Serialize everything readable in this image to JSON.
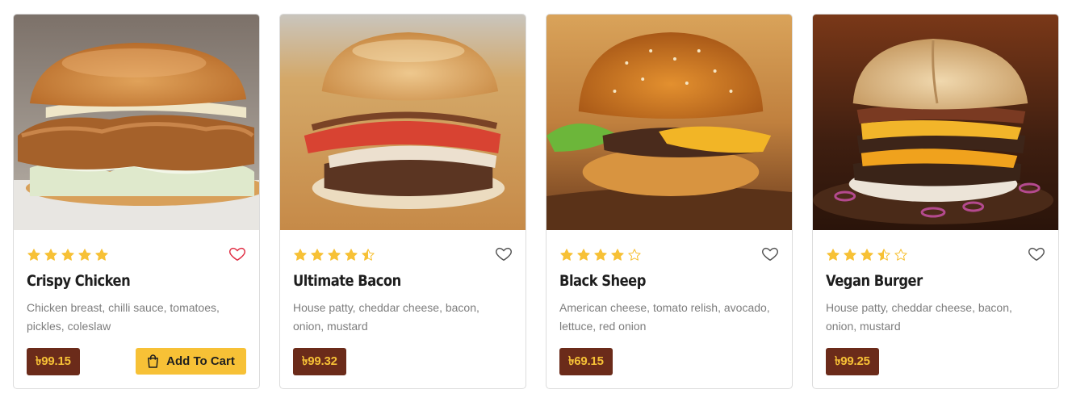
{
  "colors": {
    "star": "#f7c136",
    "heart_active": "#e02f45",
    "heart_inactive": "#555555",
    "price_bg": "#6b2b1a",
    "price_text": "#f7c136",
    "button_bg": "#f7c136"
  },
  "products": [
    {
      "name": "Crispy Chicken",
      "description": "Chicken breast, chilli sauce, tomatoes, pickles, coleslaw",
      "price": "৳99.15",
      "rating": 5,
      "favorited": true,
      "cart_label": "Add To Cart",
      "cart_icon": "shopping-bag-icon"
    },
    {
      "name": "Ultimate Bacon",
      "description": "House patty, cheddar cheese, bacon, onion, mustard",
      "price": "৳99.32",
      "rating": 4.5,
      "favorited": false
    },
    {
      "name": "Black Sheep",
      "description": "American cheese, tomato relish, avocado, lettuce, red onion",
      "price": "৳69.15",
      "rating": 4,
      "favorited": false
    },
    {
      "name": "Vegan Burger",
      "description": "House patty, cheddar cheese, bacon, onion, mustard",
      "price": "৳99.25",
      "rating": 3.5,
      "favorited": false
    }
  ]
}
